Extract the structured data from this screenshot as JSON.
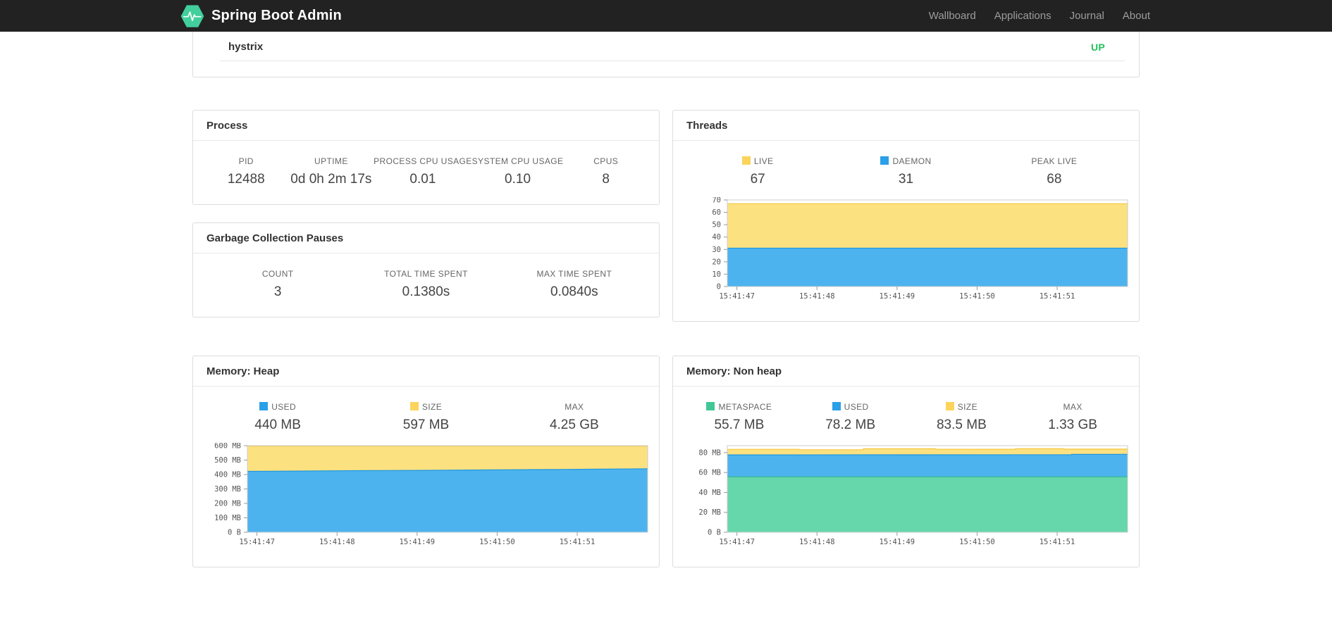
{
  "navbar": {
    "brand": "Spring Boot Admin",
    "background": "#222222",
    "brand_logo_color": "#42cf9d",
    "items": [
      {
        "label": "Wallboard"
      },
      {
        "label": "Applications"
      },
      {
        "label": "Journal"
      },
      {
        "label": "About"
      }
    ]
  },
  "application_row": {
    "name": "hystrix",
    "status": "UP",
    "status_color": "#24c15b"
  },
  "panels": {
    "process": {
      "title": "Process",
      "stats": [
        {
          "label": "PID",
          "value": "12488"
        },
        {
          "label": "UPTIME",
          "value": "0d 0h 2m 17s"
        },
        {
          "label": "PROCESS CPU USAGE",
          "value": "0.01"
        },
        {
          "label": "SYSTEM CPU USAGE",
          "value": "0.10"
        },
        {
          "label": "CPUS",
          "value": "8"
        }
      ]
    },
    "gc": {
      "title": "Garbage Collection Pauses",
      "stats": [
        {
          "label": "COUNT",
          "value": "3"
        },
        {
          "label": "TOTAL TIME SPENT",
          "value": "0.1380s"
        },
        {
          "label": "MAX TIME SPENT",
          "value": "0.0840s"
        }
      ]
    },
    "threads": {
      "title": "Threads",
      "stats": [
        {
          "label": "LIVE",
          "value": "67",
          "swatch": "#fbd45c"
        },
        {
          "label": "DAEMON",
          "value": "31",
          "swatch": "#2b9fe8"
        },
        {
          "label": "PEAK LIVE",
          "value": "68"
        }
      ]
    },
    "memory_heap": {
      "title": "Memory: Heap",
      "stats": [
        {
          "label": "USED",
          "value": "440 MB",
          "swatch": "#2b9fe8"
        },
        {
          "label": "SIZE",
          "value": "597 MB",
          "swatch": "#fbd45c"
        },
        {
          "label": "MAX",
          "value": "4.25 GB"
        }
      ]
    },
    "memory_nonheap": {
      "title": "Memory: Non heap",
      "stats": [
        {
          "label": "METASPACE",
          "value": "55.7 MB",
          "swatch": "#41c795"
        },
        {
          "label": "USED",
          "value": "78.2 MB",
          "swatch": "#2b9fe8"
        },
        {
          "label": "SIZE",
          "value": "83.5 MB",
          "swatch": "#fbd45c"
        },
        {
          "label": "MAX",
          "value": "1.33 GB"
        }
      ]
    }
  },
  "chart_data": [
    {
      "id": "threads",
      "type": "area",
      "title": "Threads",
      "xlabel": "",
      "ylabel": "",
      "grid": "border-only",
      "legend_position": "stats-row-above",
      "x_domain": [
        0,
        5
      ],
      "x_tick_positions": [
        0.12,
        1.12,
        2.12,
        3.12,
        4.12
      ],
      "x_tick_labels": [
        "15:41:47",
        "15:41:48",
        "15:41:49",
        "15:41:50",
        "15:41:51"
      ],
      "ylim": [
        0,
        70
      ],
      "y_tick_values": [
        0,
        10,
        20,
        30,
        40,
        50,
        60,
        70
      ],
      "y_tick_labels": [
        "0",
        "10",
        "20",
        "30",
        "40",
        "50",
        "60",
        "70"
      ],
      "series": [
        {
          "name": "LIVE",
          "line": "#f5c73f",
          "fill": "#fce181",
          "points": [
            [
              0,
              67
            ],
            [
              5,
              67
            ]
          ]
        },
        {
          "name": "DAEMON",
          "line": "#1e97e0",
          "fill": "#4db3ee",
          "points": [
            [
              0,
              31
            ],
            [
              5,
              31
            ]
          ]
        }
      ]
    },
    {
      "id": "heap",
      "type": "area",
      "title": "Memory: Heap",
      "xlabel": "",
      "ylabel": "",
      "grid": "border-only",
      "legend_position": "stats-row-above",
      "x_domain": [
        0,
        5
      ],
      "x_tick_positions": [
        0.12,
        1.12,
        2.12,
        3.12,
        4.12
      ],
      "x_tick_labels": [
        "15:41:47",
        "15:41:48",
        "15:41:49",
        "15:41:50",
        "15:41:51"
      ],
      "ylim": [
        0,
        600
      ],
      "y_unit": "MB",
      "y_tick_values": [
        0,
        100,
        200,
        300,
        400,
        500,
        600
      ],
      "y_tick_labels": [
        "0 B",
        "100 MB",
        "200 MB",
        "300 MB",
        "400 MB",
        "500 MB",
        "600 MB"
      ],
      "series": [
        {
          "name": "SIZE",
          "line": "#f5c73f",
          "fill": "#fce181",
          "points": [
            [
              0,
              597
            ],
            [
              5,
              597
            ]
          ]
        },
        {
          "name": "USED",
          "line": "#1e97e0",
          "fill": "#4db3ee",
          "points": [
            [
              0,
              422
            ],
            [
              0.6,
              424
            ],
            [
              1.1,
              426
            ],
            [
              1.7,
              428
            ],
            [
              2.2,
              429
            ],
            [
              2.8,
              431
            ],
            [
              3.3,
              433
            ],
            [
              3.9,
              435
            ],
            [
              4.4,
              437
            ],
            [
              5,
              440
            ]
          ]
        }
      ]
    },
    {
      "id": "nonheap",
      "type": "area",
      "title": "Memory: Non heap",
      "xlabel": "",
      "ylabel": "",
      "grid": "border-only",
      "legend_position": "stats-row-above",
      "x_domain": [
        0,
        5
      ],
      "x_tick_positions": [
        0.12,
        1.12,
        2.12,
        3.12,
        4.12
      ],
      "x_tick_labels": [
        "15:41:47",
        "15:41:48",
        "15:41:49",
        "15:41:50",
        "15:41:51"
      ],
      "ylim": [
        0,
        87
      ],
      "y_unit": "MB",
      "y_tick_values": [
        0,
        20,
        40,
        60,
        80
      ],
      "y_tick_labels": [
        "0 B",
        "20 MB",
        "40 MB",
        "60 MB",
        "80 MB"
      ],
      "series": [
        {
          "name": "SIZE",
          "line": "#f5c73f",
          "fill": "#fce181",
          "points": [
            [
              0,
              83.3
            ],
            [
              0.9,
              83.3
            ],
            [
              0.9,
              82.9
            ],
            [
              1.7,
              82.9
            ],
            [
              1.7,
              83.9
            ],
            [
              2.6,
              83.9
            ],
            [
              2.6,
              83.4
            ],
            [
              3.6,
              83.4
            ],
            [
              3.6,
              84.0
            ],
            [
              4.2,
              84.0
            ],
            [
              4.2,
              83.5
            ],
            [
              5,
              83.5
            ]
          ]
        },
        {
          "name": "USED",
          "line": "#1e97e0",
          "fill": "#4db3ee",
          "points": [
            [
              0,
              77.7
            ],
            [
              2.4,
              77.8
            ],
            [
              4.3,
              77.9
            ],
            [
              4.3,
              78.2
            ],
            [
              5,
              78.2
            ]
          ]
        },
        {
          "name": "METASPACE",
          "line": "#35b988",
          "fill": "#66d7ab",
          "points": [
            [
              0,
              55.7
            ],
            [
              5,
              55.7
            ]
          ]
        }
      ]
    }
  ]
}
